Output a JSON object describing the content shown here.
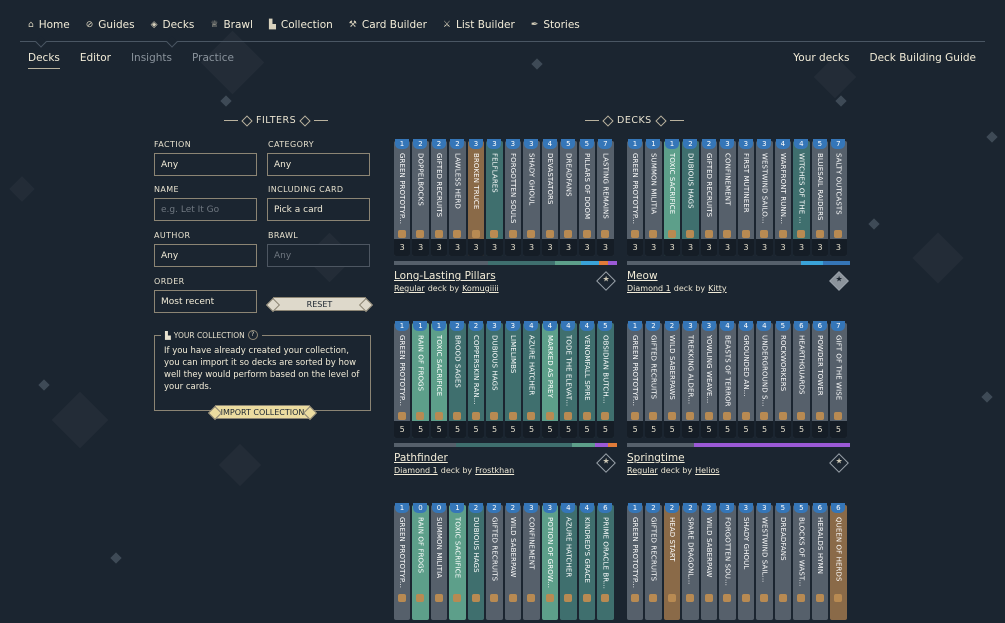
{
  "nav": [
    {
      "label": "Home",
      "icon": "home-icon",
      "glyph": "⌂"
    },
    {
      "label": "Guides",
      "icon": "compass-icon",
      "glyph": "⊘"
    },
    {
      "label": "Decks",
      "icon": "cards-icon",
      "glyph": "◈"
    },
    {
      "label": "Brawl",
      "icon": "crown-icon",
      "glyph": "♕"
    },
    {
      "label": "Collection",
      "icon": "collection-icon",
      "glyph": "▙"
    },
    {
      "label": "Card Builder",
      "icon": "hammer-icon",
      "glyph": "⚒"
    },
    {
      "label": "List Builder",
      "icon": "tool-icon",
      "glyph": "⚔"
    },
    {
      "label": "Stories",
      "icon": "feather-icon",
      "glyph": "✒"
    }
  ],
  "subnav": [
    "Decks",
    "Editor",
    "Insights",
    "Practice"
  ],
  "subnav_right": [
    "Your decks",
    "Deck Building Guide"
  ],
  "filters": {
    "heading": "FILTERS",
    "faction_label": "FACTION",
    "faction_value": "Any",
    "category_label": "CATEGORY",
    "category_value": "Any",
    "name_label": "NAME",
    "name_placeholder": "e.g. Let It Go",
    "including_label": "INCLUDING CARD",
    "including_value": "Pick a card",
    "author_label": "AUTHOR",
    "author_value": "Any",
    "brawl_label": "BRAWL",
    "brawl_value": "Any",
    "order_label": "ORDER",
    "order_value": "Most recent",
    "reset_label": "RESET"
  },
  "collection": {
    "heading": "YOUR COLLECTION",
    "help": "?",
    "text": "If you have already created your collection, you can import it so decks are sorted by how well they would perform based on the level of your cards.",
    "button": "IMPORT COLLECTION"
  },
  "decks_heading": "DECKS",
  "colors": {
    "blue": "#3576b8",
    "teal": "#3f6f6e",
    "green": "#5d9f8a",
    "grey": "#56606b",
    "brown": "#8a6a48",
    "orange": "#e07b39",
    "purple": "#9b59d6",
    "cyan": "#3aa3d8",
    "gold": "#ecdca0"
  },
  "decks": [
    {
      "name": "Long-Lasting Pillars",
      "league": "Regular",
      "by": "deck by",
      "author": "Komugiiii",
      "star": "outline",
      "bar": [
        [
          "grey",
          42
        ],
        [
          "teal",
          30
        ],
        [
          "green",
          12
        ],
        [
          "cyan",
          8
        ],
        [
          "orange",
          4
        ],
        [
          "purple",
          4
        ]
      ],
      "cards": [
        {
          "c": "1",
          "n": "GREEN PROTOTYP...",
          "col": "grey",
          "l": "3"
        },
        {
          "c": "2",
          "n": "DOPPELBOCKS",
          "col": "grey",
          "l": "3"
        },
        {
          "c": "2",
          "n": "GIFTED RECRUITS",
          "col": "grey",
          "l": "3"
        },
        {
          "c": "2",
          "n": "LAWLESS HERD",
          "col": "grey",
          "l": "3"
        },
        {
          "c": "3",
          "n": "BROKEN TRUCE",
          "col": "brown",
          "l": "3"
        },
        {
          "c": "3",
          "n": "FELFLARES",
          "col": "teal",
          "l": "3"
        },
        {
          "c": "3",
          "n": "FORGOTTEN SOULS",
          "col": "grey",
          "l": "3"
        },
        {
          "c": "3",
          "n": "SHADY GHOUL",
          "col": "grey",
          "l": "3"
        },
        {
          "c": "4",
          "n": "DEVASTATORS",
          "col": "grey",
          "l": "3"
        },
        {
          "c": "5",
          "n": "DREADFANS",
          "col": "grey",
          "l": "3"
        },
        {
          "c": "5",
          "n": "PILLARS OF DOOM",
          "col": "grey",
          "l": "3"
        },
        {
          "c": "7",
          "n": "LASTING REMAINS",
          "col": "grey",
          "l": "3"
        }
      ]
    },
    {
      "name": "Meow",
      "league": "Diamond 1",
      "by": "deck by",
      "author": "Kitty",
      "star": "filled",
      "bar": [
        [
          "grey",
          78
        ],
        [
          "cyan",
          10
        ],
        [
          "blue",
          12
        ]
      ],
      "cards": [
        {
          "c": "1",
          "n": "GREEN PROTOTYP...",
          "col": "grey",
          "l": "3"
        },
        {
          "c": "1",
          "n": "SUMMON MILITIA",
          "col": "grey",
          "l": "3"
        },
        {
          "c": "1",
          "n": "TOXIC SACRIFICE",
          "col": "green",
          "l": "3"
        },
        {
          "c": "2",
          "n": "DUBIOUS HAGS",
          "col": "teal",
          "l": "3"
        },
        {
          "c": "2",
          "n": "GIFTED RECRUITS",
          "col": "grey",
          "l": "3"
        },
        {
          "c": "3",
          "n": "CONFINEMENT",
          "col": "grey",
          "l": "3"
        },
        {
          "c": "3",
          "n": "FIRST MUTINEER",
          "col": "grey",
          "l": "3"
        },
        {
          "c": "3",
          "n": "WESTWIND SAILO...",
          "col": "grey",
          "l": "3"
        },
        {
          "c": "4",
          "n": "WARFRONT RUNN...",
          "col": "grey",
          "l": "3"
        },
        {
          "c": "4",
          "n": "WITCHES OF THE ...",
          "col": "teal",
          "l": "3"
        },
        {
          "c": "5",
          "n": "BLUESAIL RAIDERS",
          "col": "grey",
          "l": "3"
        },
        {
          "c": "7",
          "n": "SALTY OUTCASTS",
          "col": "grey",
          "l": "3"
        }
      ]
    },
    {
      "name": "Pathfinder",
      "league": "Diamond 1",
      "by": "deck by",
      "author": "Frostkhan",
      "star": "outline",
      "bar": [
        [
          "grey",
          28
        ],
        [
          "teal",
          52
        ],
        [
          "green",
          10
        ],
        [
          "purple",
          6
        ],
        [
          "orange",
          4
        ]
      ],
      "cards": [
        {
          "c": "1",
          "n": "GREEN PROTOTYP...",
          "col": "grey",
          "l": "5"
        },
        {
          "c": "1",
          "n": "RAIN OF FROGS",
          "col": "green",
          "l": "5"
        },
        {
          "c": "1",
          "n": "TOXIC SACRIFICE",
          "col": "green",
          "l": "5"
        },
        {
          "c": "2",
          "n": "BROOD SAGES",
          "col": "teal",
          "l": "5"
        },
        {
          "c": "2",
          "n": "COPPERSKIN RAN...",
          "col": "teal",
          "l": "5"
        },
        {
          "c": "3",
          "n": "DUBIOUS HAGS",
          "col": "teal",
          "l": "5"
        },
        {
          "c": "3",
          "n": "LIMELIMBS",
          "col": "teal",
          "l": "5"
        },
        {
          "c": "4",
          "n": "AZURE HATCHER",
          "col": "teal",
          "l": "5"
        },
        {
          "c": "4",
          "n": "MARKED AS PREY",
          "col": "green",
          "l": "5"
        },
        {
          "c": "4",
          "n": "TODE THE ELEVAT...",
          "col": "teal",
          "l": "5"
        },
        {
          "c": "4",
          "n": "VENOMFALL SPIRE",
          "col": "teal",
          "l": "5"
        },
        {
          "c": "5",
          "n": "OBSIDIAN BUTCH...",
          "col": "teal",
          "l": "5"
        }
      ]
    },
    {
      "name": "Springtime",
      "league": "Regular",
      "by": "deck by",
      "author": "Helios",
      "star": "outline",
      "bar": [
        [
          "grey",
          30
        ],
        [
          "purple",
          70
        ]
      ],
      "cards": [
        {
          "c": "1",
          "n": "GREEN PROTOTYP...",
          "col": "grey",
          "l": "5"
        },
        {
          "c": "2",
          "n": "GIFTED RECRUITS",
          "col": "grey",
          "l": "5"
        },
        {
          "c": "2",
          "n": "WILD SABERPAWS",
          "col": "grey",
          "l": "5"
        },
        {
          "c": "3",
          "n": "TREKKING ALDER...",
          "col": "grey",
          "l": "5"
        },
        {
          "c": "3",
          "n": "YOWLING WEAVE...",
          "col": "grey",
          "l": "5"
        },
        {
          "c": "4",
          "n": "BEASTS OF TERROR",
          "col": "grey",
          "l": "5"
        },
        {
          "c": "4",
          "n": "GROUNDED AN...",
          "col": "grey",
          "l": "5"
        },
        {
          "c": "4",
          "n": "UNDERGROUND S...",
          "col": "grey",
          "l": "5"
        },
        {
          "c": "5",
          "n": "ROCKWORKERS",
          "col": "grey",
          "l": "5"
        },
        {
          "c": "6",
          "n": "HEARTHGUARDS",
          "col": "grey",
          "l": "5"
        },
        {
          "c": "6",
          "n": "POWDER TOWER",
          "col": "grey",
          "l": "5"
        },
        {
          "c": "7",
          "n": "GIFT OF THE WISE",
          "col": "grey",
          "l": "5"
        }
      ]
    },
    {
      "name": "",
      "league": "",
      "by": "",
      "author": "",
      "star": "none",
      "bar": [],
      "cards": [
        {
          "c": "1",
          "n": "GREEN PROTOTYP...",
          "col": "grey",
          "l": ""
        },
        {
          "c": "0",
          "n": "RAIN OF FROGS",
          "col": "green",
          "l": ""
        },
        {
          "c": "0",
          "n": "SUMMON MILITIA",
          "col": "grey",
          "l": ""
        },
        {
          "c": "1",
          "n": "TOXIC SACRIFICE",
          "col": "green",
          "l": ""
        },
        {
          "c": "2",
          "n": "DUBIOUS HAGS",
          "col": "teal",
          "l": ""
        },
        {
          "c": "2",
          "n": "GIFTED RECRUITS",
          "col": "grey",
          "l": ""
        },
        {
          "c": "2",
          "n": "WILD SABERPAW",
          "col": "grey",
          "l": ""
        },
        {
          "c": "3",
          "n": "CONFINEMENT",
          "col": "grey",
          "l": ""
        },
        {
          "c": "3",
          "n": "POTION OF GROW...",
          "col": "green",
          "l": ""
        },
        {
          "c": "4",
          "n": "AZURE HATCHER",
          "col": "teal",
          "l": ""
        },
        {
          "c": "4",
          "n": "KINDRED'S GRACE",
          "col": "teal",
          "l": ""
        },
        {
          "c": "6",
          "n": "PRIME ORACLE BR...",
          "col": "teal",
          "l": ""
        }
      ]
    },
    {
      "name": "",
      "league": "",
      "by": "",
      "author": "",
      "star": "none",
      "bar": [],
      "cards": [
        {
          "c": "1",
          "n": "GREEN PROTOTYP...",
          "col": "grey",
          "l": ""
        },
        {
          "c": "2",
          "n": "GIFTED RECRUITS",
          "col": "grey",
          "l": ""
        },
        {
          "c": "2",
          "n": "HEAD START",
          "col": "brown",
          "l": ""
        },
        {
          "c": "2",
          "n": "SPARE DRAGONL...",
          "col": "grey",
          "l": ""
        },
        {
          "c": "2",
          "n": "WILD SABERPAW",
          "col": "grey",
          "l": ""
        },
        {
          "c": "3",
          "n": "FORGOTTEN SOU...",
          "col": "grey",
          "l": ""
        },
        {
          "c": "3",
          "n": "SHADY GHOUL",
          "col": "grey",
          "l": ""
        },
        {
          "c": "3",
          "n": "WESTWIND SAIL...",
          "col": "grey",
          "l": ""
        },
        {
          "c": "5",
          "n": "DREADFANS",
          "col": "grey",
          "l": ""
        },
        {
          "c": "5",
          "n": "BLOCKS OF WAST...",
          "col": "grey",
          "l": ""
        },
        {
          "c": "6",
          "n": "HERALDS HYMN",
          "col": "grey",
          "l": ""
        },
        {
          "c": "6",
          "n": "QUEEN OF HERDS",
          "col": "brown",
          "l": ""
        }
      ]
    }
  ]
}
